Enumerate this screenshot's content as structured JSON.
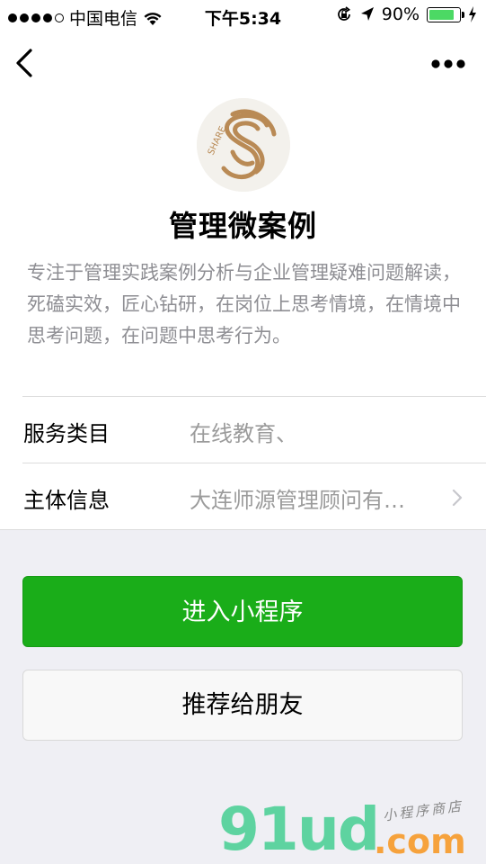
{
  "status_bar": {
    "carrier": "中国电信",
    "time": "下午5:34",
    "battery_percent_text": "90%",
    "battery_level": 0.9,
    "battery_color": "#4cd964"
  },
  "nav": {
    "back_icon": "chevron-left-icon",
    "more_icon": "more-dots-icon"
  },
  "profile": {
    "logo_text": "SHARE",
    "name": "管理微案例",
    "description": "专注于管理实践案例分析与企业管理疑难问题解读，死磕实效，匠心钻研，在岗位上思考情境，在情境中思考问题，在问题中思考行为。"
  },
  "info_rows": [
    {
      "label": "服务类目",
      "value": "在线教育、"
    },
    {
      "label": "主体信息",
      "value": "大连师源管理顾问有…"
    }
  ],
  "buttons": {
    "enter": "进入小程序",
    "recommend": "推荐给朋友"
  },
  "watermark": {
    "brand": "91ud",
    "domain": ".com",
    "tagline": "小程序商店"
  },
  "colors": {
    "primary_button": "#1aad19",
    "page_background": "#efeff4"
  }
}
